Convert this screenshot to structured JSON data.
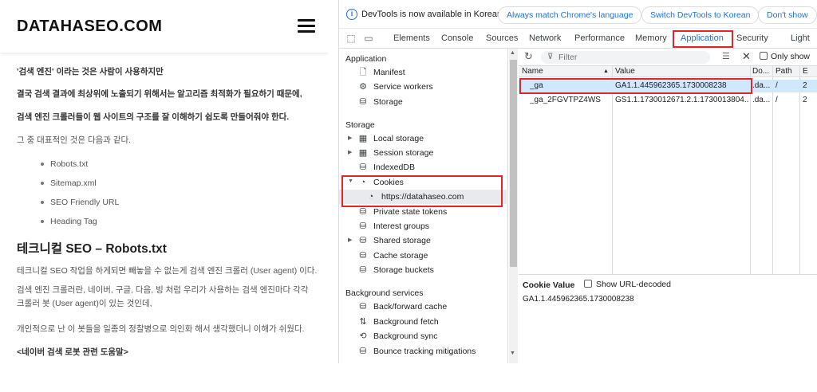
{
  "site": {
    "logo": "DATAHASEO.COM",
    "paragraphs": {
      "p1": "'검색 엔진' 이라는 것은 사람이 사용하지만",
      "p2": "결국 검색 결과에 최상위에 노출되기 위해서는 알고리즘 최적화가 필요하기 때문에,",
      "p3": "검색 엔진 크롤러들이 웹 사이트의 구조를 잘 이해하기 쉽도록 만들어줘야 한다.",
      "p4": "그 중 대표적인 것은 다음과 같다.",
      "p5": "테크니컬 SEO 작업을 하게되면 빼놓을 수 없는게 검색 엔진 크롤러 (User agent) 이다.",
      "p6": "검색 엔진 크롤러란, 네이버, 구글, 다음, 빙 처럼 우리가 사용하는 검색 엔진마다 각각 크롤러 봇 (User agent)이 있는 것인데,",
      "p7": "개인적으로 난 이 봇들을 일종의 정찰병으로 의인화 해서 생각했더니 이해가 쉬웠다.",
      "p8": "<네이버 검색 로봇 관련 도움말>"
    },
    "list": [
      "Robots.txt",
      "Sitemap.xml",
      "SEO Friendly URL",
      "Heading Tag"
    ],
    "heading": "테크니컬 SEO – Robots.txt"
  },
  "devtools": {
    "infobar": {
      "text": "DevTools is now available in Korean!",
      "btn_match": "Always match Chrome's language",
      "btn_switch": "Switch DevTools to Korean",
      "btn_dont": "Don't show"
    },
    "tabs": [
      "Elements",
      "Console",
      "Sources",
      "Network",
      "Performance",
      "Memory",
      "Application",
      "Security",
      "Light"
    ],
    "active_tab": "Application",
    "sidebar": {
      "application_title": "Application",
      "application_items": [
        "Manifest",
        "Service workers",
        "Storage"
      ],
      "storage_title": "Storage",
      "storage_items": [
        "Local storage",
        "Session storage",
        "IndexedDB",
        "Cookies",
        "https://datahaseo.com",
        "Private state tokens",
        "Interest groups",
        "Shared storage",
        "Cache storage",
        "Storage buckets"
      ],
      "bg_title": "Background services",
      "bg_items": [
        "Back/forward cache",
        "Background fetch",
        "Background sync",
        "Bounce tracking mitigations"
      ]
    },
    "toolbar": {
      "filter_placeholder": "Filter",
      "only_show": "Only show"
    },
    "grid": {
      "headers": [
        "Name",
        "Value",
        "Do...",
        "Path",
        "E"
      ],
      "rows": [
        [
          "_ga",
          "GA1.1.445962365.1730008238",
          ".da...",
          "/",
          "2"
        ],
        [
          "_ga_2FGVTPZ4WS",
          "GS1.1.1730012671.2.1.1730013804....",
          ".da...",
          "/",
          "2"
        ]
      ]
    },
    "cookie_value": {
      "title": "Cookie Value",
      "show_decoded": "Show URL-decoded",
      "value": "GA1.1.445962365.1730008238"
    },
    "colors": {
      "accent": "#1a73e8",
      "highlight": "#e0262a",
      "selected_row": "#cfe8fc"
    }
  }
}
